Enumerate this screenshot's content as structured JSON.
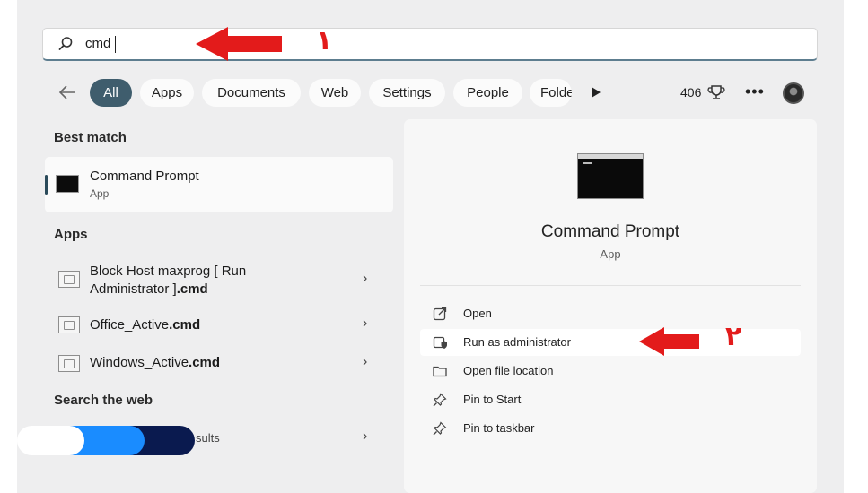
{
  "search": {
    "value": "cmd",
    "icon": "search-icon"
  },
  "filters": {
    "back_icon": "back-arrow-icon",
    "chips": [
      {
        "label": "All",
        "active": true
      },
      {
        "label": "Apps",
        "active": false
      },
      {
        "label": "Documents",
        "active": false
      },
      {
        "label": "Web",
        "active": false
      },
      {
        "label": "Settings",
        "active": false
      },
      {
        "label": "People",
        "active": false
      },
      {
        "label": "Folde",
        "active": false
      }
    ],
    "points": "406"
  },
  "left": {
    "best_match_heading": "Best match",
    "best": {
      "name": "Command Prompt",
      "type": "App"
    },
    "apps_heading": "Apps",
    "apps": [
      {
        "line1": "Block Host maxprog [ Run",
        "line2_plain": "Administrator ]",
        "line2_bold": ".cmd"
      },
      {
        "plain": "Office_Active",
        "bold": ".cmd"
      },
      {
        "plain": "Windows_Active",
        "bold": ".cmd"
      }
    ],
    "web_heading": "Search the web",
    "web_item_partial": "sults"
  },
  "preview": {
    "title": "Command Prompt",
    "subtitle": "App",
    "actions": [
      {
        "label": "Open",
        "icon": "open-external-icon"
      },
      {
        "label": "Run as administrator",
        "icon": "shield-icon"
      },
      {
        "label": "Open file location",
        "icon": "folder-icon"
      },
      {
        "label": "Pin to Start",
        "icon": "pin-icon"
      },
      {
        "label": "Pin to taskbar",
        "icon": "pin-icon"
      }
    ]
  },
  "annotations": {
    "step1": "١",
    "step2": "٢",
    "arrow_color": "#e31b1b"
  }
}
